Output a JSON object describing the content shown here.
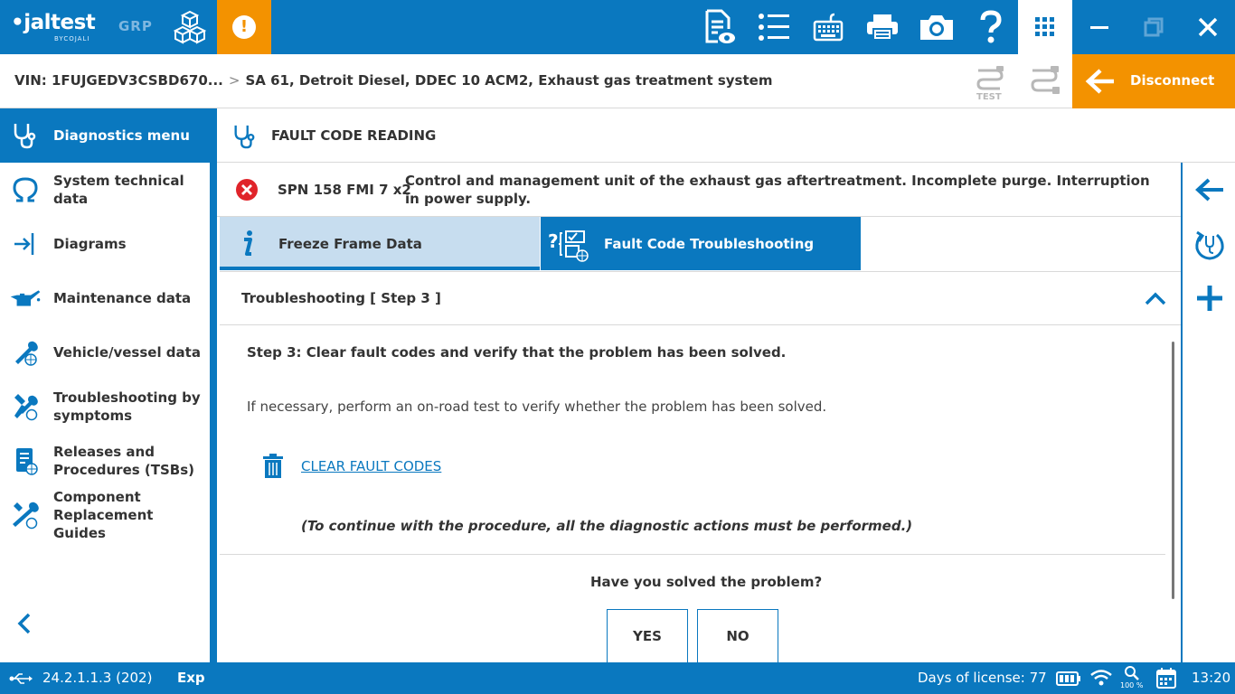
{
  "app": {
    "brand": "jaltest",
    "brand_sub": "BYCOJALI",
    "grp": "GRP"
  },
  "vehicle": {
    "vin": "VIN: 1FUJGEDV3CSBD670...",
    "separator": ">",
    "system": "SA 61, Detroit Diesel, DDEC 10 ACM2, Exhaust gas treatment system"
  },
  "toolbar": {
    "test_label": "TEST",
    "disconnect_label": "Disconnect"
  },
  "sidebar": {
    "header": "Diagnostics menu",
    "items": [
      {
        "label": "System technical data",
        "icon": "omega-icon"
      },
      {
        "label": "Diagrams",
        "icon": "diagram-icon"
      },
      {
        "label": "Maintenance data",
        "icon": "oil-can-icon"
      },
      {
        "label": "Vehicle/vessel data",
        "icon": "wrench-globe-icon"
      },
      {
        "label": "Troubleshooting by symptoms",
        "icon": "tools-globe-icon"
      },
      {
        "label": "Releases and Procedures (TSBs)",
        "icon": "document-globe-icon"
      },
      {
        "label": "Component Replacement Guides",
        "icon": "tools-guide-icon"
      }
    ]
  },
  "main": {
    "title": "FAULT CODE READING",
    "fault": {
      "code": "SPN 158 FMI 7  x2",
      "description": "Control and management unit of the exhaust gas aftertreatment. Incomplete purge. Interruption in power supply."
    },
    "tabs": [
      {
        "label": "Freeze Frame Data"
      },
      {
        "label": "Fault Code Troubleshooting"
      }
    ],
    "step_header": "Troubleshooting [ Step 3 ]",
    "step_title": "Step 3: Clear fault codes and verify that the problem has been solved.",
    "step_text": "If necessary, perform an on-road test to verify whether the problem has been solved.",
    "clear_link": "CLEAR FAULT CODES",
    "note": "(To continue with the procedure, all the diagnostic actions must be performed.)",
    "question": "Have you solved the problem?",
    "yes": "YES",
    "no": "NO"
  },
  "status": {
    "version": "24.2.1.1.3 (202)",
    "mode": "Exp",
    "license": "Days of license: 77",
    "zoom": "100 %",
    "time": "13:20"
  },
  "colors": {
    "primary": "#0a78bf",
    "accent": "#f39200",
    "tab_active_bg": "#c7ddef",
    "error": "#e0242a"
  }
}
